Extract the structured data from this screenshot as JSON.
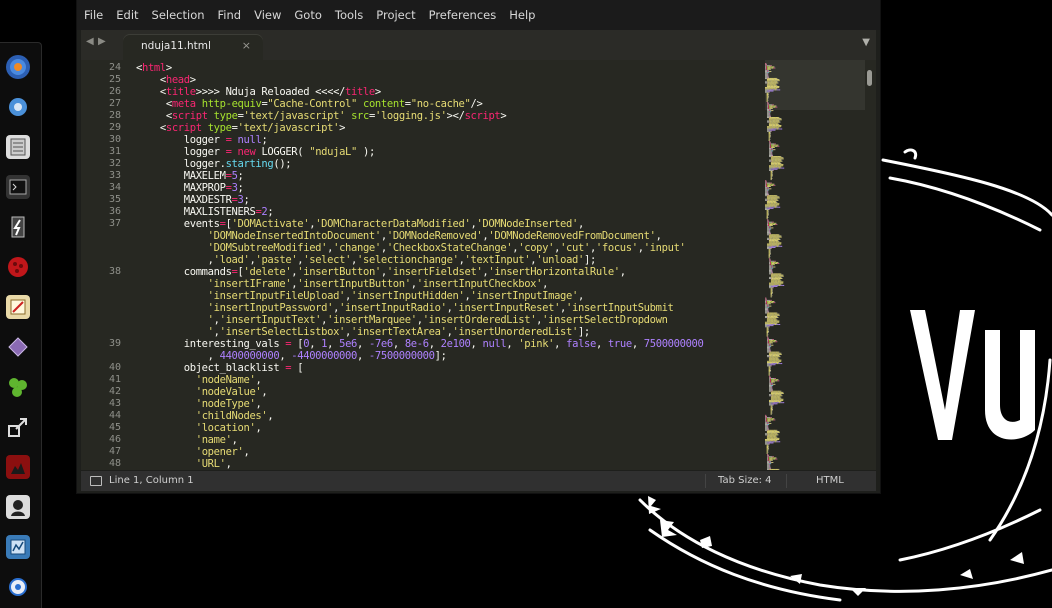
{
  "menu": [
    "File",
    "Edit",
    "Selection",
    "Find",
    "View",
    "Goto",
    "Tools",
    "Project",
    "Preferences",
    "Help"
  ],
  "tab": {
    "title": "nduja11.html",
    "close": "×"
  },
  "nav": {
    "back": "◀",
    "forward": "▶",
    "overflow": "▼"
  },
  "code": {
    "line_numbers": [
      "24",
      "25",
      "26",
      "27",
      "28",
      "29",
      "30",
      "31",
      "32",
      "33",
      "34",
      "35",
      "36",
      "37",
      "",
      "",
      "",
      "38",
      "",
      "",
      "",
      "",
      "",
      "39",
      "",
      "40",
      "41",
      "42",
      "43",
      "44",
      "45",
      "46",
      "47",
      "48"
    ],
    "lines": [
      [
        [
          "t",
          "<"
        ],
        [
          "k",
          "html"
        ],
        [
          "t",
          ">"
        ]
      ],
      [
        [
          "t",
          "    <"
        ],
        [
          "k",
          "head"
        ],
        [
          "t",
          ">"
        ]
      ],
      [
        [
          "t",
          "    <"
        ],
        [
          "k",
          "title"
        ],
        [
          "t",
          ">>>> Nduja Reloaded <<<</"
        ],
        [
          "k",
          "title"
        ],
        [
          "t",
          ">"
        ]
      ],
      [
        [
          "t",
          "     <"
        ],
        [
          "k",
          "meta"
        ],
        [
          "t",
          " "
        ],
        [
          "a",
          "http-equiv"
        ],
        [
          "t",
          "="
        ],
        [
          "s",
          "\"Cache-Control\""
        ],
        [
          "t",
          " "
        ],
        [
          "a",
          "content"
        ],
        [
          "t",
          "="
        ],
        [
          "s",
          "\"no-cache\""
        ],
        [
          "t",
          "/>"
        ]
      ],
      [
        [
          "t",
          "     <"
        ],
        [
          "k",
          "script"
        ],
        [
          "t",
          " "
        ],
        [
          "a",
          "type"
        ],
        [
          "t",
          "="
        ],
        [
          "s",
          "'text/javascript'"
        ],
        [
          "t",
          " "
        ],
        [
          "a",
          "src"
        ],
        [
          "t",
          "="
        ],
        [
          "s",
          "'logging.js'"
        ],
        [
          "t",
          "></"
        ],
        [
          "k",
          "script"
        ],
        [
          "t",
          ">"
        ]
      ],
      [
        [
          "t",
          "    <"
        ],
        [
          "k",
          "script"
        ],
        [
          "t",
          " "
        ],
        [
          "a",
          "type"
        ],
        [
          "t",
          "="
        ],
        [
          "s",
          "'text/javascript'"
        ],
        [
          "t",
          ">"
        ]
      ],
      [
        [
          "t",
          "        logger "
        ],
        [
          "k",
          "="
        ],
        [
          "t",
          " "
        ],
        [
          "n",
          "null"
        ],
        [
          "t",
          ";"
        ]
      ],
      [
        [
          "t",
          "        logger "
        ],
        [
          "k",
          "="
        ],
        [
          "t",
          " "
        ],
        [
          "k",
          "new"
        ],
        [
          "t",
          " LOGGER( "
        ],
        [
          "s",
          "\"ndujaL\""
        ],
        [
          "t",
          " );"
        ]
      ],
      [
        [
          "t",
          "        logger."
        ],
        [
          "c",
          "starting"
        ],
        [
          "t",
          "();"
        ]
      ],
      [
        [
          "t",
          "        MAXELEM"
        ],
        [
          "k",
          "="
        ],
        [
          "n",
          "5"
        ],
        [
          "t",
          ";"
        ]
      ],
      [
        [
          "t",
          "        MAXPROP"
        ],
        [
          "k",
          "="
        ],
        [
          "n",
          "3"
        ],
        [
          "t",
          ";"
        ]
      ],
      [
        [
          "t",
          "        MAXDESTR"
        ],
        [
          "k",
          "="
        ],
        [
          "n",
          "3"
        ],
        [
          "t",
          ";"
        ]
      ],
      [
        [
          "t",
          "        MAXLISTENERS"
        ],
        [
          "k",
          "="
        ],
        [
          "n",
          "2"
        ],
        [
          "t",
          ";"
        ]
      ],
      [
        [
          "t",
          "        events"
        ],
        [
          "k",
          "="
        ],
        [
          "t",
          "["
        ],
        [
          "s",
          "'DOMActivate'"
        ],
        [
          "t",
          ","
        ],
        [
          "s",
          "'DOMCharacterDataModified'"
        ],
        [
          "t",
          ","
        ],
        [
          "s",
          "'DOMNodeInserted'"
        ],
        [
          "t",
          ","
        ]
      ],
      [
        [
          "t",
          "            "
        ],
        [
          "s",
          "'DOMNodeInsertedIntoDocument'"
        ],
        [
          "t",
          ","
        ],
        [
          "s",
          "'DOMNodeRemoved'"
        ],
        [
          "t",
          ","
        ],
        [
          "s",
          "'DOMNodeRemovedFromDocument'"
        ],
        [
          "t",
          ","
        ]
      ],
      [
        [
          "t",
          "            "
        ],
        [
          "s",
          "'DOMSubtreeModified'"
        ],
        [
          "t",
          ","
        ],
        [
          "s",
          "'change'"
        ],
        [
          "t",
          ","
        ],
        [
          "s",
          "'CheckboxStateChange'"
        ],
        [
          "t",
          ","
        ],
        [
          "s",
          "'copy'"
        ],
        [
          "t",
          ","
        ],
        [
          "s",
          "'cut'"
        ],
        [
          "t",
          ","
        ],
        [
          "s",
          "'focus'"
        ],
        [
          "t",
          ","
        ],
        [
          "s",
          "'input'"
        ]
      ],
      [
        [
          "t",
          "            ,"
        ],
        [
          "s",
          "'load'"
        ],
        [
          "t",
          ","
        ],
        [
          "s",
          "'paste'"
        ],
        [
          "t",
          ","
        ],
        [
          "s",
          "'select'"
        ],
        [
          "t",
          ","
        ],
        [
          "s",
          "'selectionchange'"
        ],
        [
          "t",
          ","
        ],
        [
          "s",
          "'textInput'"
        ],
        [
          "t",
          ","
        ],
        [
          "s",
          "'unload'"
        ],
        [
          "t",
          "];"
        ]
      ],
      [
        [
          "t",
          "        commands"
        ],
        [
          "k",
          "="
        ],
        [
          "t",
          "["
        ],
        [
          "s",
          "'delete'"
        ],
        [
          "t",
          ","
        ],
        [
          "s",
          "'insertButton'"
        ],
        [
          "t",
          ","
        ],
        [
          "s",
          "'insertFieldset'"
        ],
        [
          "t",
          ","
        ],
        [
          "s",
          "'insertHorizontalRule'"
        ],
        [
          "t",
          ","
        ]
      ],
      [
        [
          "t",
          "            "
        ],
        [
          "s",
          "'insertIFrame'"
        ],
        [
          "t",
          ","
        ],
        [
          "s",
          "'insertInputButton'"
        ],
        [
          "t",
          ","
        ],
        [
          "s",
          "'insertInputCheckbox'"
        ],
        [
          "t",
          ","
        ]
      ],
      [
        [
          "t",
          "            "
        ],
        [
          "s",
          "'insertInputFileUpload'"
        ],
        [
          "t",
          ","
        ],
        [
          "s",
          "'insertInputHidden'"
        ],
        [
          "t",
          ","
        ],
        [
          "s",
          "'insertInputImage'"
        ],
        [
          "t",
          ","
        ]
      ],
      [
        [
          "t",
          "            "
        ],
        [
          "s",
          "'insertInputPassword'"
        ],
        [
          "t",
          ","
        ],
        [
          "s",
          "'insertInputRadio'"
        ],
        [
          "t",
          ","
        ],
        [
          "s",
          "'insertInputReset'"
        ],
        [
          "t",
          ","
        ],
        [
          "s",
          "'insertInputSubmit"
        ]
      ],
      [
        [
          "s",
          "            '"
        ],
        [
          "t",
          ","
        ],
        [
          "s",
          "'insertInputText'"
        ],
        [
          "t",
          ","
        ],
        [
          "s",
          "'insertMarquee'"
        ],
        [
          "t",
          ","
        ],
        [
          "s",
          "'insertOrderedList'"
        ],
        [
          "t",
          ","
        ],
        [
          "s",
          "'insertSelectDropdown"
        ]
      ],
      [
        [
          "s",
          "            '"
        ],
        [
          "t",
          ","
        ],
        [
          "s",
          "'insertSelectListbox'"
        ],
        [
          "t",
          ","
        ],
        [
          "s",
          "'insertTextArea'"
        ],
        [
          "t",
          ","
        ],
        [
          "s",
          "'insertUnorderedList'"
        ],
        [
          "t",
          "];"
        ]
      ],
      [
        [
          "t",
          "        interesting_vals "
        ],
        [
          "k",
          "="
        ],
        [
          "t",
          " ["
        ],
        [
          "n",
          "0"
        ],
        [
          "t",
          ", "
        ],
        [
          "n",
          "1"
        ],
        [
          "t",
          ", "
        ],
        [
          "n",
          "5e6"
        ],
        [
          "t",
          ", "
        ],
        [
          "n",
          "-7e6"
        ],
        [
          "t",
          ", "
        ],
        [
          "n",
          "8e-6"
        ],
        [
          "t",
          ", "
        ],
        [
          "n",
          "2e100"
        ],
        [
          "t",
          ", "
        ],
        [
          "n",
          "null"
        ],
        [
          "t",
          ", "
        ],
        [
          "s",
          "'pink'"
        ],
        [
          "t",
          ", "
        ],
        [
          "n",
          "false"
        ],
        [
          "t",
          ", "
        ],
        [
          "n",
          "true"
        ],
        [
          "t",
          ", "
        ],
        [
          "n",
          "7500000000"
        ]
      ],
      [
        [
          "t",
          "            , "
        ],
        [
          "n",
          "4400000000"
        ],
        [
          "t",
          ", "
        ],
        [
          "n",
          "-4400000000"
        ],
        [
          "t",
          ", "
        ],
        [
          "n",
          "-7500000000"
        ],
        [
          "t",
          "];"
        ]
      ],
      [
        [
          "t",
          "        object_blacklist "
        ],
        [
          "k",
          "="
        ],
        [
          "t",
          " ["
        ]
      ],
      [
        [
          "t",
          "          "
        ],
        [
          "s",
          "'nodeName'"
        ],
        [
          "t",
          ","
        ]
      ],
      [
        [
          "t",
          "          "
        ],
        [
          "s",
          "'nodeValue'"
        ],
        [
          "t",
          ","
        ]
      ],
      [
        [
          "t",
          "          "
        ],
        [
          "s",
          "'nodeType'"
        ],
        [
          "t",
          ","
        ]
      ],
      [
        [
          "t",
          "          "
        ],
        [
          "s",
          "'childNodes'"
        ],
        [
          "t",
          ","
        ]
      ],
      [
        [
          "t",
          "          "
        ],
        [
          "s",
          "'location'"
        ],
        [
          "t",
          ","
        ]
      ],
      [
        [
          "t",
          "          "
        ],
        [
          "s",
          "'name'"
        ],
        [
          "t",
          ","
        ]
      ],
      [
        [
          "t",
          "          "
        ],
        [
          "s",
          "'opener'"
        ],
        [
          "t",
          ","
        ]
      ],
      [
        [
          "t",
          "          "
        ],
        [
          "s",
          "'URL'"
        ],
        [
          "t",
          ","
        ]
      ]
    ]
  },
  "status": {
    "position": "Line 1, Column 1",
    "tab_size": "Tab Size: 4",
    "syntax": "HTML"
  },
  "dock_icons": [
    "browser-icon",
    "chrome-icon",
    "files-icon",
    "terminal-icon",
    "app-icon",
    "bug-icon",
    "text-editor-icon",
    "package-icon",
    "molecule-icon",
    "screenshot-icon",
    "image-icon",
    "avatar-icon",
    "chart-app-icon",
    "blue-circle-icon"
  ],
  "colors": {
    "keyword": "#f92672",
    "string": "#e6db74",
    "attribute": "#a6e22e",
    "number": "#ae81ff",
    "function": "#66d9ef",
    "background": "#272822"
  }
}
